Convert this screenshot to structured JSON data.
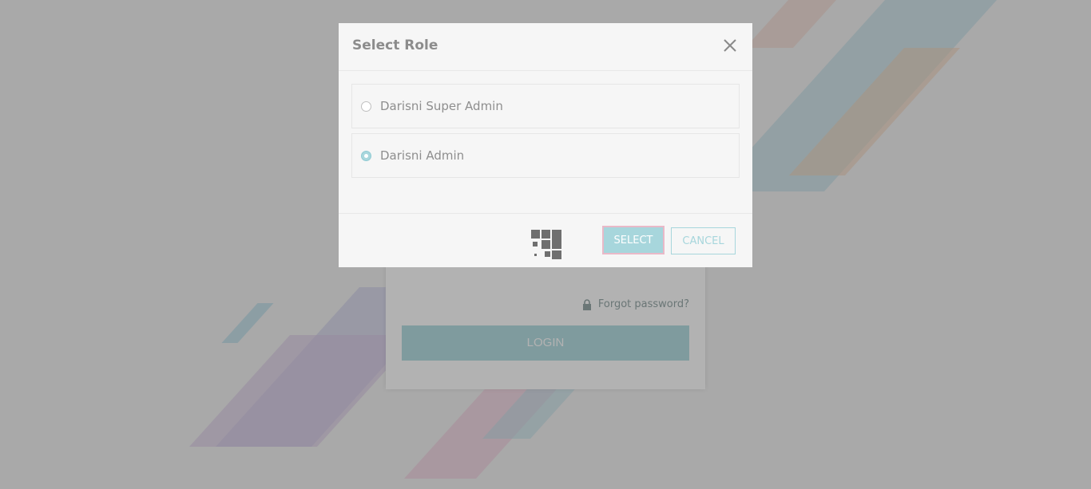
{
  "modal": {
    "title": "Select Role",
    "options": [
      {
        "label": "Darisni Super Admin",
        "selected": false
      },
      {
        "label": "Darisni Admin",
        "selected": true
      }
    ],
    "select_label": "SELECT",
    "cancel_label": "CANCEL"
  },
  "login": {
    "forgot_label": "Forgot password?",
    "login_label": "LOGIN"
  },
  "colors": {
    "accent": "#a7d6dc",
    "overlay": "rgba(0,0,0,0.30)"
  },
  "icons": {
    "close": "close-icon",
    "loader": "loader-icon",
    "lock": "lock-icon"
  }
}
